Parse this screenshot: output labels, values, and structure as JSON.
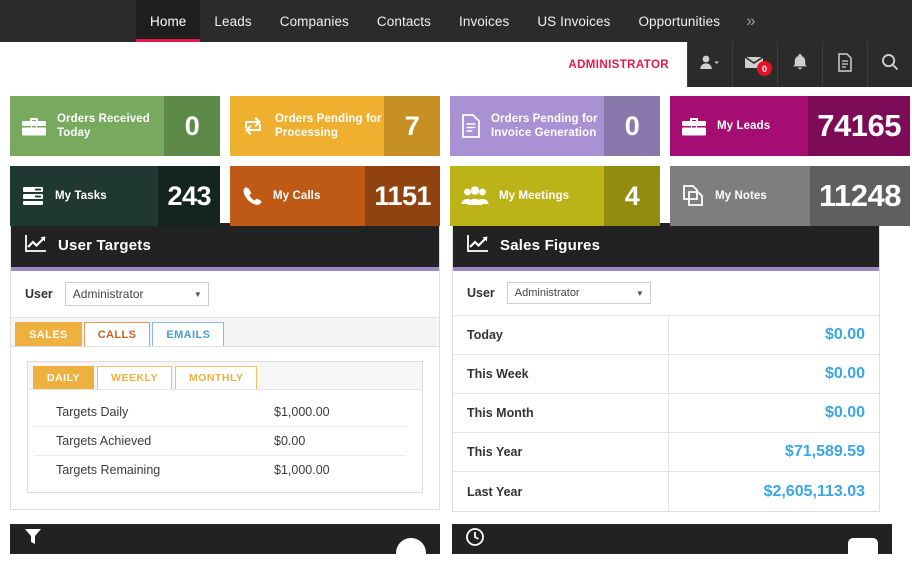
{
  "nav": {
    "items": [
      {
        "label": "Home",
        "active": true
      },
      {
        "label": "Leads",
        "active": false
      },
      {
        "label": "Companies",
        "active": false
      },
      {
        "label": "Contacts",
        "active": false
      },
      {
        "label": "Invoices",
        "active": false
      },
      {
        "label": "US Invoices",
        "active": false
      },
      {
        "label": "Opportunities",
        "active": false
      }
    ],
    "more_icon": "»"
  },
  "header": {
    "admin_label": "ADMINISTRATOR",
    "icons": [
      {
        "name": "user-chevron-icon"
      },
      {
        "name": "envelope-icon",
        "badge": "0"
      },
      {
        "name": "bell-icon"
      },
      {
        "name": "document-icon"
      },
      {
        "name": "search-icon"
      }
    ]
  },
  "tiles": [
    {
      "label": "Orders Received Today",
      "value": "0",
      "icon": "briefcase-icon",
      "bg": "#77aa5f",
      "value_bg": "#5d8a48",
      "wide": false
    },
    {
      "label": "Orders Pending for Processing",
      "value": "7",
      "icon": "recycle-icon",
      "bg": "#eeb02e",
      "value_bg": "#c79024",
      "wide": false
    },
    {
      "label": "Orders Pending for Invoice Generation",
      "value": "0",
      "icon": "document-icon",
      "bg": "#a991d4",
      "value_bg": "#8878ab",
      "wide": false
    },
    {
      "label": "My Leads",
      "value": "74165",
      "icon": "briefcase-icon",
      "bg": "#a50d72",
      "value_bg": "#7d0b57",
      "wide": true
    },
    {
      "label": "My Tasks",
      "value": "243",
      "icon": "tasks-icon",
      "bg": "#1f3832",
      "value_bg": "#14241f",
      "wide": false
    },
    {
      "label": "My Calls",
      "value": "1151",
      "icon": "phone-icon",
      "bg": "#bf5a16",
      "value_bg": "#90420f",
      "wide": false
    },
    {
      "label": "My Meetings",
      "value": "4",
      "icon": "users-icon",
      "bg": "#bcb318",
      "value_bg": "#938c11",
      "wide": false
    },
    {
      "label": "My Notes",
      "value": "11248",
      "icon": "notes-icon",
      "bg": "#7e7e7e",
      "value_bg": "#5f5f5f",
      "wide": true
    }
  ],
  "user_targets": {
    "panel_title": "User Targets",
    "panel_icon": "chart-line-icon",
    "user_label": "User",
    "user_value": "Administrator",
    "tabs": [
      {
        "label": "SALES",
        "active": true
      },
      {
        "label": "CALLS",
        "active": false
      },
      {
        "label": "EMAILS",
        "active": false
      }
    ],
    "period_tabs": [
      {
        "label": "DAILY",
        "active": true
      },
      {
        "label": "WEEKLY",
        "active": false
      },
      {
        "label": "MONTHLY",
        "active": false
      }
    ],
    "rows": [
      {
        "key": "Targets Daily",
        "value": "$1,000.00"
      },
      {
        "key": "Targets Achieved",
        "value": "$0.00"
      },
      {
        "key": "Targets Remaining",
        "value": "$1,000.00"
      }
    ]
  },
  "sales_figures": {
    "panel_title": "Sales Figures",
    "panel_icon": "chart-line-icon",
    "user_label": "User",
    "user_value": "Administrator",
    "rows": [
      {
        "key": "Today",
        "value": "$0.00"
      },
      {
        "key": "This Week",
        "value": "$0.00"
      },
      {
        "key": "This Month",
        "value": "$0.00"
      },
      {
        "key": "This Year",
        "value": "$71,589.59"
      },
      {
        "key": "Last Year",
        "value": "$2,605,113.03"
      }
    ],
    "value_color": "#3aa6e8"
  },
  "bottom_panels": [
    {
      "title": "",
      "icon": "funnel-icon"
    },
    {
      "title": "",
      "icon": "clock-icon"
    }
  ],
  "colors": {
    "nav_bg": "#2b2b2b",
    "accent_pink": "#e8174a",
    "panel_header_bg": "#222222",
    "panel_accent": "#9b8bc4",
    "amber": "#eeb03e"
  }
}
